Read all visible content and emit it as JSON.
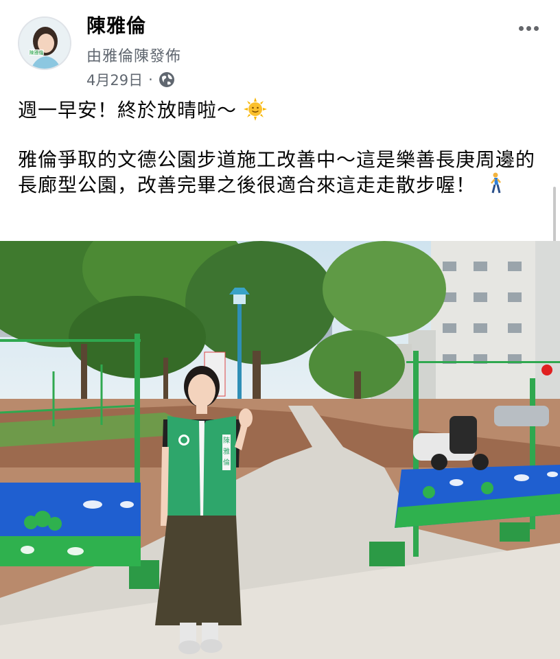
{
  "post": {
    "author": "陳雅倫",
    "posted_by": "由雅倫陳發佈",
    "date": "4月29日",
    "separator": "·",
    "privacy_icon": "globe-icon",
    "more_icon": "more-horizontal-icon",
    "avatar_badge": "陳雅倫",
    "text": {
      "line1": "週一早安！終於放晴啦～",
      "line1_emoji": "sun-face-emoji",
      "paragraph2": "雅倫爭取的文德公園步道施工改善中～這是樂善長庚周邊的長廊型公園，改善完畢之後很適合來這走走散步喔！",
      "paragraph2_emoji": "walking-person-emoji"
    }
  },
  "photo": {
    "vest_text": "陳雅倫"
  },
  "colors": {
    "name": "#050505",
    "meta": "#606770",
    "fence": "#2fa84f",
    "vest": "#2ea66b",
    "banner": "#1f5fd0"
  }
}
